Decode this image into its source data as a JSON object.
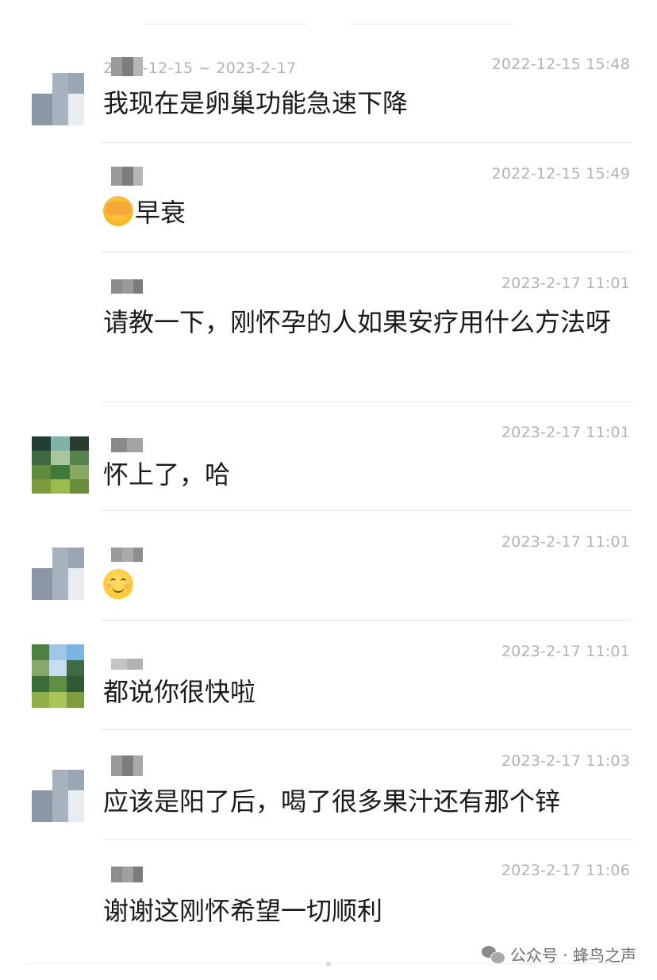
{
  "header": {
    "date_range": "2022-12-15 ~ 2023-2-17"
  },
  "messages": [
    {
      "time": "2022-12-15 15:48",
      "text": "我现在是卵巢功能急速下降",
      "avatar": "blurred-gray"
    },
    {
      "time": "2022-12-15 15:49",
      "text": "早衰",
      "emoji": "facepalm-icon"
    },
    {
      "time": "2023-2-17 11:01",
      "text": "请教一下，刚怀孕的人如果安疗用什么方法呀"
    },
    {
      "time": "2023-2-17 11:01",
      "text": "怀上了，哈",
      "avatar": "blurred-green"
    },
    {
      "time": "2023-2-17 11:01",
      "text": "",
      "emoji": "smiling-face-icon",
      "avatar": "blurred-gray"
    },
    {
      "time": "2023-2-17 11:01",
      "text": "都说你很快啦",
      "avatar": "blurred-green-sky"
    },
    {
      "time": "2023-2-17 11:03",
      "text": "应该是阳了后，喝了很多果汁还有那个锌",
      "avatar": "blurred-gray"
    },
    {
      "time": "2023-2-17 11:06",
      "text": "谢谢这刚怀希望一切顺利"
    }
  ],
  "watermark": {
    "text": "公众号 · 蜂鸟之声",
    "icon": "wechat-icon"
  },
  "colors": {
    "timestamp": "#b3b3b3",
    "text": "#1a1a1a",
    "divider": "#e8e8e8"
  }
}
